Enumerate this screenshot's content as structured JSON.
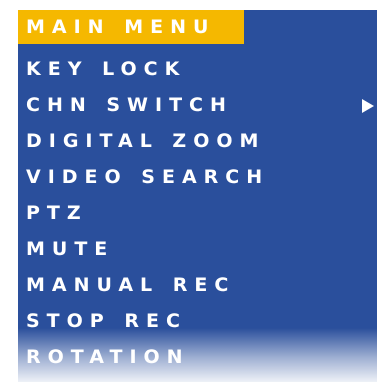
{
  "menu": {
    "title": "MAIN MENU",
    "items": [
      {
        "label": "KEY LOCK"
      },
      {
        "label": "CHN SWITCH",
        "icon": "play-arrow-icon"
      },
      {
        "label": "DIGITAL ZOOM"
      },
      {
        "label": "VIDEO SEARCH"
      },
      {
        "label": "PTZ"
      },
      {
        "label": "MUTE"
      },
      {
        "label": "MANUAL REC"
      },
      {
        "label": "STOP REC"
      },
      {
        "label": "ROTATION"
      }
    ]
  },
  "colors": {
    "panel_bg": "#2a4f9c",
    "title_bg": "#f5b800",
    "text": "#ffffff"
  }
}
